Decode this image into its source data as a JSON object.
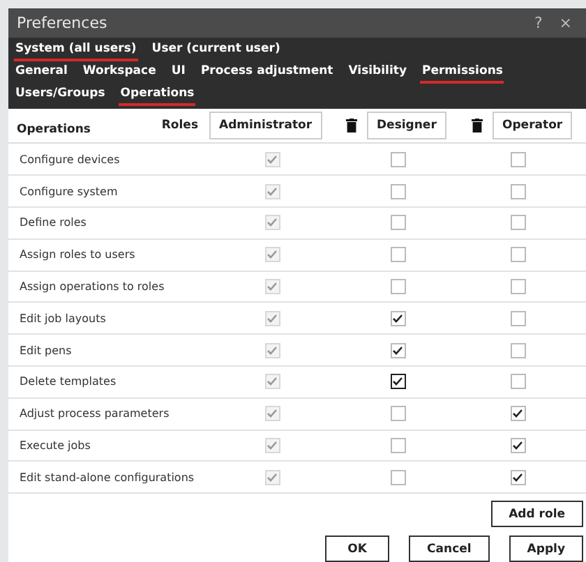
{
  "window": {
    "title": "Preferences",
    "help": "?",
    "close": "×"
  },
  "tab_rows": [
    [
      {
        "label": "System (all users)",
        "selected": true
      },
      {
        "label": "User (current user)",
        "selected": false
      }
    ],
    [
      {
        "label": "General",
        "selected": false
      },
      {
        "label": "Workspace",
        "selected": false
      },
      {
        "label": "UI",
        "selected": false
      },
      {
        "label": "Process adjustment",
        "selected": false
      },
      {
        "label": "Visibility",
        "selected": false
      },
      {
        "label": "Permissions",
        "selected": true
      }
    ],
    [
      {
        "label": "Users/Groups",
        "selected": false
      },
      {
        "label": "Operations",
        "selected": true
      }
    ]
  ],
  "table": {
    "operations_header": "Operations",
    "roles_header": "Roles",
    "roles": [
      {
        "name": "Administrator",
        "deletable": false
      },
      {
        "name": "Designer",
        "deletable": true
      },
      {
        "name": "Operator",
        "deletable": true
      }
    ],
    "rows": [
      {
        "label": "Configure devices",
        "cells": [
          {
            "checked": true,
            "disabled": true,
            "focused": false
          },
          {
            "checked": false,
            "disabled": false,
            "focused": false
          },
          {
            "checked": false,
            "disabled": false,
            "focused": false
          }
        ]
      },
      {
        "label": "Configure system",
        "cells": [
          {
            "checked": true,
            "disabled": true,
            "focused": false
          },
          {
            "checked": false,
            "disabled": false,
            "focused": false
          },
          {
            "checked": false,
            "disabled": false,
            "focused": false
          }
        ]
      },
      {
        "label": "Define roles",
        "cells": [
          {
            "checked": true,
            "disabled": true,
            "focused": false
          },
          {
            "checked": false,
            "disabled": false,
            "focused": false
          },
          {
            "checked": false,
            "disabled": false,
            "focused": false
          }
        ]
      },
      {
        "label": "Assign roles to users",
        "cells": [
          {
            "checked": true,
            "disabled": true,
            "focused": false
          },
          {
            "checked": false,
            "disabled": false,
            "focused": false
          },
          {
            "checked": false,
            "disabled": false,
            "focused": false
          }
        ]
      },
      {
        "label": "Assign operations to roles",
        "cells": [
          {
            "checked": true,
            "disabled": true,
            "focused": false
          },
          {
            "checked": false,
            "disabled": false,
            "focused": false
          },
          {
            "checked": false,
            "disabled": false,
            "focused": false
          }
        ]
      },
      {
        "label": "Edit job layouts",
        "cells": [
          {
            "checked": true,
            "disabled": true,
            "focused": false
          },
          {
            "checked": true,
            "disabled": false,
            "focused": false
          },
          {
            "checked": false,
            "disabled": false,
            "focused": false
          }
        ]
      },
      {
        "label": "Edit pens",
        "cells": [
          {
            "checked": true,
            "disabled": true,
            "focused": false
          },
          {
            "checked": true,
            "disabled": false,
            "focused": false
          },
          {
            "checked": false,
            "disabled": false,
            "focused": false
          }
        ]
      },
      {
        "label": "Delete templates",
        "cells": [
          {
            "checked": true,
            "disabled": true,
            "focused": false
          },
          {
            "checked": true,
            "disabled": false,
            "focused": true
          },
          {
            "checked": false,
            "disabled": false,
            "focused": false
          }
        ]
      },
      {
        "label": "Adjust process parameters",
        "cells": [
          {
            "checked": true,
            "disabled": true,
            "focused": false
          },
          {
            "checked": false,
            "disabled": false,
            "focused": false
          },
          {
            "checked": true,
            "disabled": false,
            "focused": false
          }
        ]
      },
      {
        "label": "Execute jobs",
        "cells": [
          {
            "checked": true,
            "disabled": true,
            "focused": false
          },
          {
            "checked": false,
            "disabled": false,
            "focused": false
          },
          {
            "checked": true,
            "disabled": false,
            "focused": false
          }
        ]
      },
      {
        "label": "Edit stand-alone configurations",
        "cells": [
          {
            "checked": true,
            "disabled": true,
            "focused": false
          },
          {
            "checked": false,
            "disabled": false,
            "focused": false
          },
          {
            "checked": true,
            "disabled": false,
            "focused": false
          }
        ]
      }
    ]
  },
  "add_role_button": "Add role",
  "buttons": [
    "OK",
    "Cancel",
    "Apply"
  ]
}
